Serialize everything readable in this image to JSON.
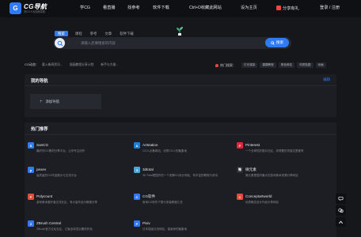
{
  "header": {
    "logo_mark": "G",
    "logo_title": "CG导航",
    "logo_subtitle": "好CG人为你而导航",
    "nav": [
      "学CG",
      "看直播",
      "找参考",
      "软件下载",
      "Ctrl+D收藏此网站",
      "设为主页",
      "分享有礼",
      "登录 / 注册"
    ]
  },
  "search": {
    "tabs": [
      "搜索",
      "课程",
      "参考",
      "文章",
      "软件下载"
    ],
    "active_tab": 0,
    "placeholder": "请输入您要搜索的内容",
    "button_label": "搜索"
  },
  "hot": {
    "left_label": "CG动态：",
    "left_items": [
      "载入新闻资讯...",
      "插画教程分享计划",
      "新手与大佬..."
    ],
    "right_label": "热门搜索：",
    "right_tags": [
      "灯光渲染",
      "建模教程",
      "角色绑定",
      "材质贴图",
      "动画"
    ]
  },
  "my_nav": {
    "title": "我的导航",
    "link": "编辑",
    "add_label": "添加导航"
  },
  "recommend": {
    "title": "热门推荐",
    "sites": [
      {
        "name": "SanCG",
        "desc": "最好的CG素材分享平台，让你专注创作",
        "icon": "sancg-icon",
        "color": "#2f7bf5",
        "glyph": "S"
      },
      {
        "name": "Artstation",
        "desc": "CG人必备网站，优秀CG人的聚集地",
        "icon": "artstation-icon",
        "color": "#1b7fd8",
        "glyph": "A"
      },
      {
        "name": "Pinterest",
        "desc": "一个全球性的图片社区，你想要的灵感这里都有",
        "icon": "pinterest-icon",
        "color": "#e0283a",
        "glyph": "P"
      },
      {
        "name": "pexev",
        "desc": "高质量的CG作品展示与交流平台",
        "icon": "pexev-icon",
        "color": "#2f7bf5",
        "glyph": "p"
      },
      {
        "name": "3dtotal",
        "desc": "3D Total是国外的一个老牌CG设计网站，有丰富的教程与资讯",
        "icon": "3dtotal-icon",
        "color": "#4aa6d8",
        "glyph": "3"
      },
      {
        "name": "微元素",
        "desc": "微元素是国内最大的游戏美术资源分享网站",
        "icon": "weiyuansu-icon",
        "color": "#2a2d33",
        "glyph": "微"
      },
      {
        "name": "Polycount",
        "desc": "游戏美术爱好者交流社区，有大量作品与教程分享",
        "icon": "polycount-icon",
        "color": "#e24b3b",
        "glyph": "P"
      },
      {
        "name": "CG软件",
        "desc": "常用CG软件下载与安装教程汇总",
        "icon": "cg-software-icon",
        "color": "#2f7bf5",
        "glyph": "C"
      },
      {
        "name": "Conceptartworld",
        "desc": "优秀概念设计作品分享网站",
        "icon": "conceptartworld-icon",
        "color": "#e24b3b",
        "glyph": "C"
      },
      {
        "name": "ZBrush Central",
        "desc": "ZBrush官方论坛社区，汇聚全球顶尖雕刻作品",
        "icon": "zbrush-icon",
        "color": "#2f7bf5",
        "glyph": "Z"
      },
      {
        "name": "Pixiv",
        "desc": "日本插画交流网站，插画师的聚集地",
        "icon": "pixiv-icon",
        "color": "#2f7bf5",
        "glyph": "P"
      },
      {
        "name": "",
        "desc": "",
        "icon": "",
        "color": "#1c1e23",
        "glyph": ""
      }
    ]
  },
  "toolbar": [
    "chat-icon",
    "wechat-icon",
    "up-arrow-icon"
  ]
}
